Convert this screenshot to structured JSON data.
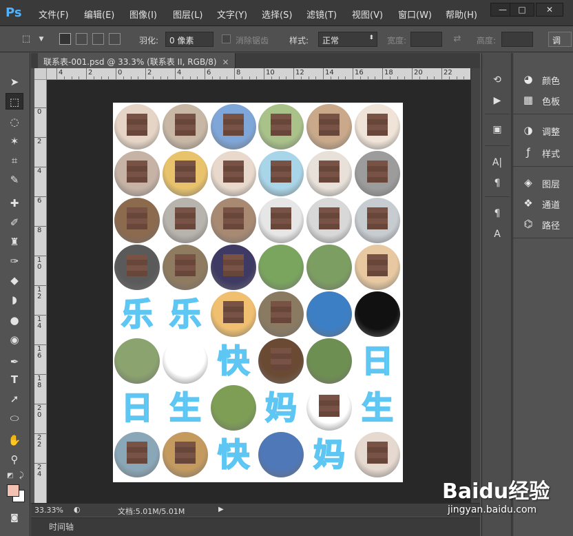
{
  "app": {
    "logo": "Ps"
  },
  "menu": [
    "文件(F)",
    "编辑(E)",
    "图像(I)",
    "图层(L)",
    "文字(Y)",
    "选择(S)",
    "滤镜(T)",
    "视图(V)",
    "窗口(W)",
    "帮助(H)"
  ],
  "window_controls": {
    "minimize": "—",
    "maximize": "□",
    "close": "✕"
  },
  "options": {
    "feather_label": "羽化:",
    "feather_value": "0 像素",
    "antialias_label": "消除锯齿",
    "style_label": "样式:",
    "style_value": "正常",
    "width_label": "宽度:",
    "height_label": "高度:",
    "adjust_label": "调"
  },
  "document": {
    "tab_title": "联系表-001.psd @ 33.3% (联系表 II, RGB/8)",
    "close_glyph": "×"
  },
  "ruler": {
    "top": [
      "4",
      "2",
      "0",
      "2",
      "4",
      "6",
      "8",
      "10",
      "12",
      "14",
      "16",
      "18",
      "20",
      "22"
    ],
    "left": [
      "0",
      "2",
      "4",
      "6",
      "8",
      "1\n0",
      "1\n2",
      "1\n4",
      "1\n6",
      "1\n8",
      "2\n0",
      "2\n2",
      "2\n4"
    ]
  },
  "status": {
    "zoom": "33.33%",
    "doc_size": "文档:5.01M/5.01M",
    "timeline": "时间轴"
  },
  "panels": [
    {
      "name": "颜色",
      "icon": "color-icon"
    },
    {
      "name": "色板",
      "icon": "swatches-icon"
    },
    {
      "name": "调整",
      "icon": "adjustments-icon"
    },
    {
      "name": "样式",
      "icon": "styles-icon"
    },
    {
      "name": "图层",
      "icon": "layers-icon"
    },
    {
      "name": "通道",
      "icon": "channels-icon"
    },
    {
      "name": "路径",
      "icon": "paths-icon"
    }
  ],
  "contact_sheet_text": {
    "row5": [
      "乐",
      "乐"
    ],
    "row6": [
      "快",
      "日"
    ],
    "row7": [
      "日",
      "生",
      "妈",
      "生"
    ],
    "row8": [
      "快",
      "妈"
    ]
  },
  "watermark": {
    "brand": "Baidu经验",
    "url": "jingyan.baidu.com"
  },
  "colors": {
    "foreground": "#f4c2b2",
    "background": "#ffffff",
    "accent_text": "#9be0ff"
  }
}
